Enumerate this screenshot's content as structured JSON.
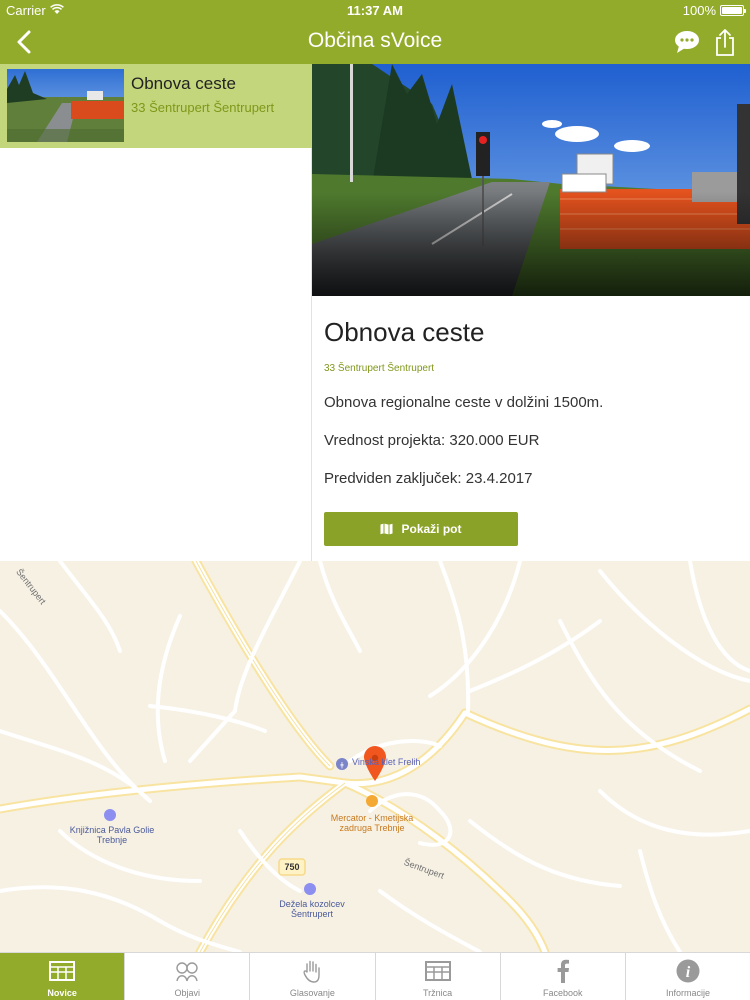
{
  "status_bar": {
    "carrier": "Carrier",
    "time": "11:37 AM",
    "battery": "100%",
    "battery_level": 1.0
  },
  "nav": {
    "title": "Občina sVoice"
  },
  "list": {
    "items": [
      {
        "title": "Obnova ceste",
        "address": "33 Šentrupert Šentrupert",
        "selected": true
      }
    ]
  },
  "detail": {
    "title": "Obnova ceste",
    "address": "33 Šentrupert Šentrupert",
    "lines": [
      "Obnova regionalne ceste v dolžini 1500m.",
      "Vrednost projekta: 320.000 EUR",
      "Predviden zaključek: 23.4.2017"
    ],
    "route_button": "Pokaži pot"
  },
  "map": {
    "labels": {
      "road_north": "Šentrupert",
      "road_south": "Šentrupert",
      "library": "Knjižnica Pavla Golie Trebnje",
      "wine_cellar": "Vinska klet Frelih",
      "mercator": "Mercator - Kmetijska zadruga Trebnje",
      "dezela": "Dežela kozolcev Šentrupert",
      "road_number": "750"
    }
  },
  "tabs": [
    {
      "label": "Novice",
      "icon": "news-grid-icon",
      "active": true
    },
    {
      "label": "Objavi",
      "icon": "report-icon",
      "active": false
    },
    {
      "label": "Glasovanje",
      "icon": "raised-hand-icon",
      "active": false
    },
    {
      "label": "Tržnica",
      "icon": "market-grid-icon",
      "active": false
    },
    {
      "label": "Facebook",
      "icon": "facebook-icon",
      "active": false
    },
    {
      "label": "Informacije",
      "icon": "info-icon",
      "active": false
    }
  ],
  "colors": {
    "brand_green": "#93ab2a",
    "selected_row": "#c4d67c",
    "link_green": "#7f971a",
    "button_green": "#8aa228",
    "map_pin": "#f0561e"
  }
}
